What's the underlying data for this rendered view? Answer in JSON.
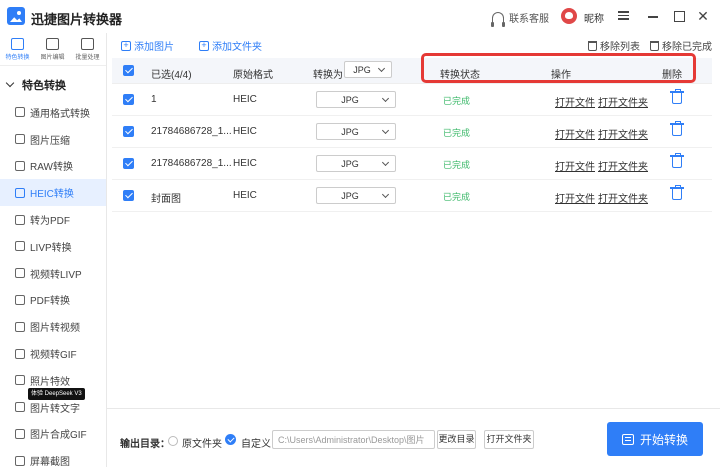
{
  "app": {
    "title": "迅捷图片转换器"
  },
  "titlebar": {
    "support": "联系客服",
    "nickname": "昵称"
  },
  "topnav": [
    "特色转换",
    "图片编辑",
    "批量处理"
  ],
  "sidebar": {
    "category": "特色转换",
    "items": [
      "通用格式转换",
      "图片压缩",
      "RAW转换",
      "HEIC转换",
      "转为PDF",
      "LIVP转换",
      "视频转LIVP",
      "PDF转换",
      "图片转视频",
      "视频转GIF",
      "照片特效",
      "图片转文字",
      "图片合成GIF",
      "屏幕截图"
    ],
    "active_index": 3,
    "badge": "体验 DeepSeek V3"
  },
  "toolbar": {
    "add_image": "添加图片",
    "add_folder": "添加文件夹",
    "remove_list": "移除列表",
    "remove_done": "移除已完成"
  },
  "table": {
    "headers": {
      "selected": "已选(4/4)",
      "orig_format": "原始格式",
      "convert_to": "转换为",
      "convert_to_value": "JPG",
      "status": "转换状态",
      "action": "操作",
      "delete": "删除"
    },
    "rows": [
      {
        "name": "1",
        "format": "HEIC",
        "target": "JPG",
        "status": "已完成",
        "open_file": "打开文件",
        "open_folder": "打开文件夹"
      },
      {
        "name": "21784686728_1...",
        "format": "HEIC",
        "target": "JPG",
        "status": "已完成",
        "open_file": "打开文件",
        "open_folder": "打开文件夹"
      },
      {
        "name": "21784686728_1...",
        "format": "HEIC",
        "target": "JPG",
        "status": "已完成",
        "open_file": "打开文件",
        "open_folder": "打开文件夹"
      },
      {
        "name": "封面图",
        "format": "HEIC",
        "target": "JPG",
        "status": "已完成",
        "open_file": "打开文件",
        "open_folder": "打开文件夹"
      }
    ]
  },
  "output": {
    "label": "输出目录：",
    "option_original": "原文件夹",
    "option_custom": "自定义",
    "path": "C:\\Users\\Administrator\\Desktop\\图片",
    "change_dir": "更改目录",
    "open_folder": "打开文件夹"
  },
  "start_button": "开始转换",
  "colors": {
    "accent": "#2f7ef7",
    "done": "#3cb96a",
    "highlight": "#e53935"
  }
}
